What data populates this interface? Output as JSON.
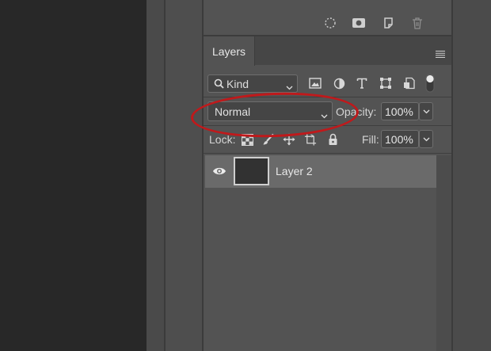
{
  "layers_panel": {
    "tab_label": "Layers",
    "filter": {
      "kind_label": "Kind"
    },
    "blend_mode": {
      "value": "Normal"
    },
    "opacity": {
      "label": "Opacity:",
      "value": "100%"
    },
    "lock": {
      "label": "Lock:"
    },
    "fill": {
      "label": "Fill:",
      "value": "100%"
    },
    "layers": [
      {
        "name": "Layer 2",
        "visible": true,
        "selected": true
      }
    ]
  },
  "annotation": {
    "shape": "ellipse",
    "color": "#c0191b",
    "highlights": "blend-mode-dropdown"
  },
  "colors": {
    "panel_bg": "#535353",
    "selected_row": "#6a6a6a",
    "canvas_bg": "#282828"
  }
}
